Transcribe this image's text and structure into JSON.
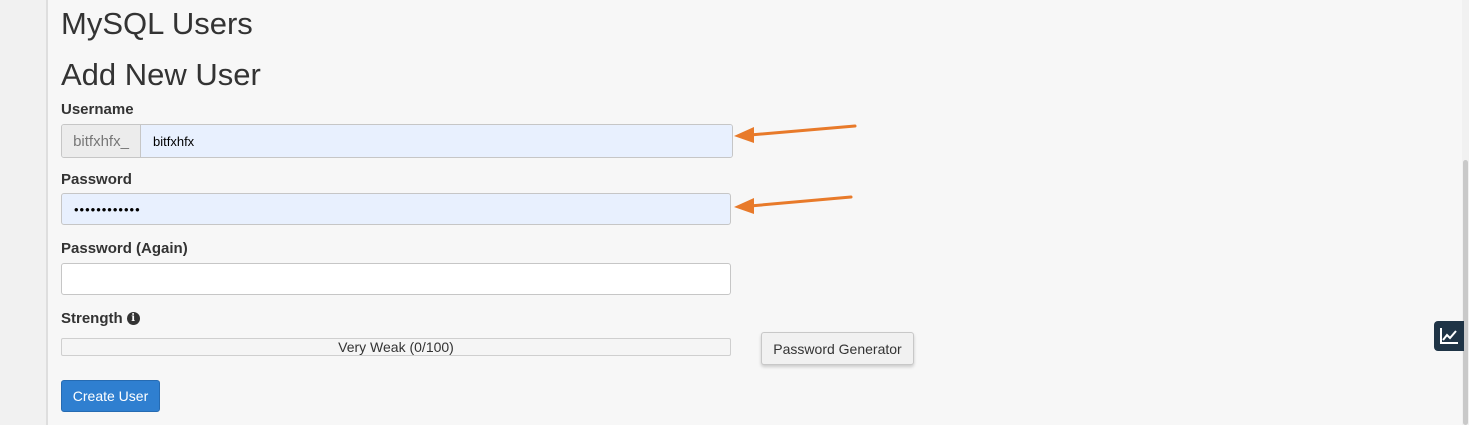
{
  "page": {
    "title": "MySQL Users",
    "section_title": "Add New User"
  },
  "form": {
    "username_label": "Username",
    "username_prefix": "bitfxhfx_",
    "username_value": "bitfxhfx",
    "password_label": "Password",
    "password_value": "••••••••••••",
    "password_again_label": "Password (Again)",
    "password_again_value": "",
    "strength_label": "Strength",
    "strength_text": "Very Weak (0/100)",
    "strength_score": 0,
    "generator_button": "Password Generator",
    "create_button": "Create User"
  },
  "annotations": {
    "arrow_color": "#e87a2a"
  },
  "colors": {
    "primary_button": "#2f7fd0",
    "autofill_background": "#e8f0fe",
    "stats_button": "#1f3446"
  },
  "icons": {
    "info": "info-icon",
    "stats": "line-chart-icon"
  }
}
